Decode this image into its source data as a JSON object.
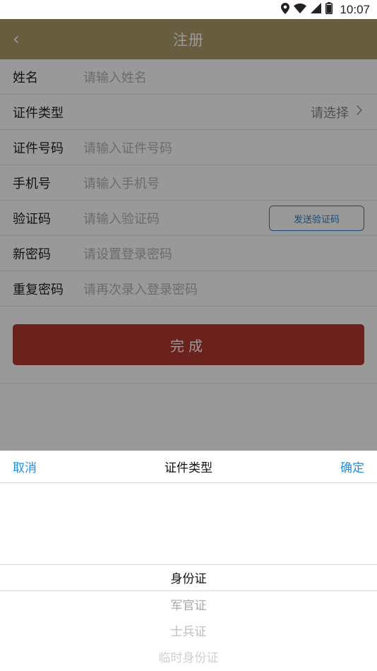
{
  "status_bar": {
    "time": "10:07",
    "icons": [
      "location-icon",
      "wifi-icon",
      "signal-icon",
      "battery-icon"
    ]
  },
  "header": {
    "back_icon": "chevron-left-icon",
    "title": "注册"
  },
  "form": {
    "name": {
      "label": "姓名",
      "placeholder": "请输入姓名"
    },
    "id_type": {
      "label": "证件类型",
      "value": "请选择"
    },
    "id_number": {
      "label": "证件号码",
      "placeholder": "请输入证件号码"
    },
    "phone": {
      "label": "手机号",
      "placeholder": "请输入手机号"
    },
    "code": {
      "label": "验证码",
      "placeholder": "请输入验证码",
      "send_button": "发送验证码"
    },
    "password": {
      "label": "新密码",
      "placeholder": "请设置登录密码"
    },
    "repeat_password": {
      "label": "重复密码",
      "placeholder": "请再次录入登录密码"
    },
    "submit": "完成"
  },
  "picker": {
    "cancel": "取消",
    "title": "证件类型",
    "confirm": "确定",
    "options": [
      "身份证",
      "军官证",
      "士兵证",
      "临时身份证"
    ],
    "selected_index": 0
  },
  "colors": {
    "header_bg": "#b09c6b",
    "submit_bg": "#b33a30",
    "accent_blue": "#1f8ee6",
    "send_code_border": "#2c7cc1"
  }
}
